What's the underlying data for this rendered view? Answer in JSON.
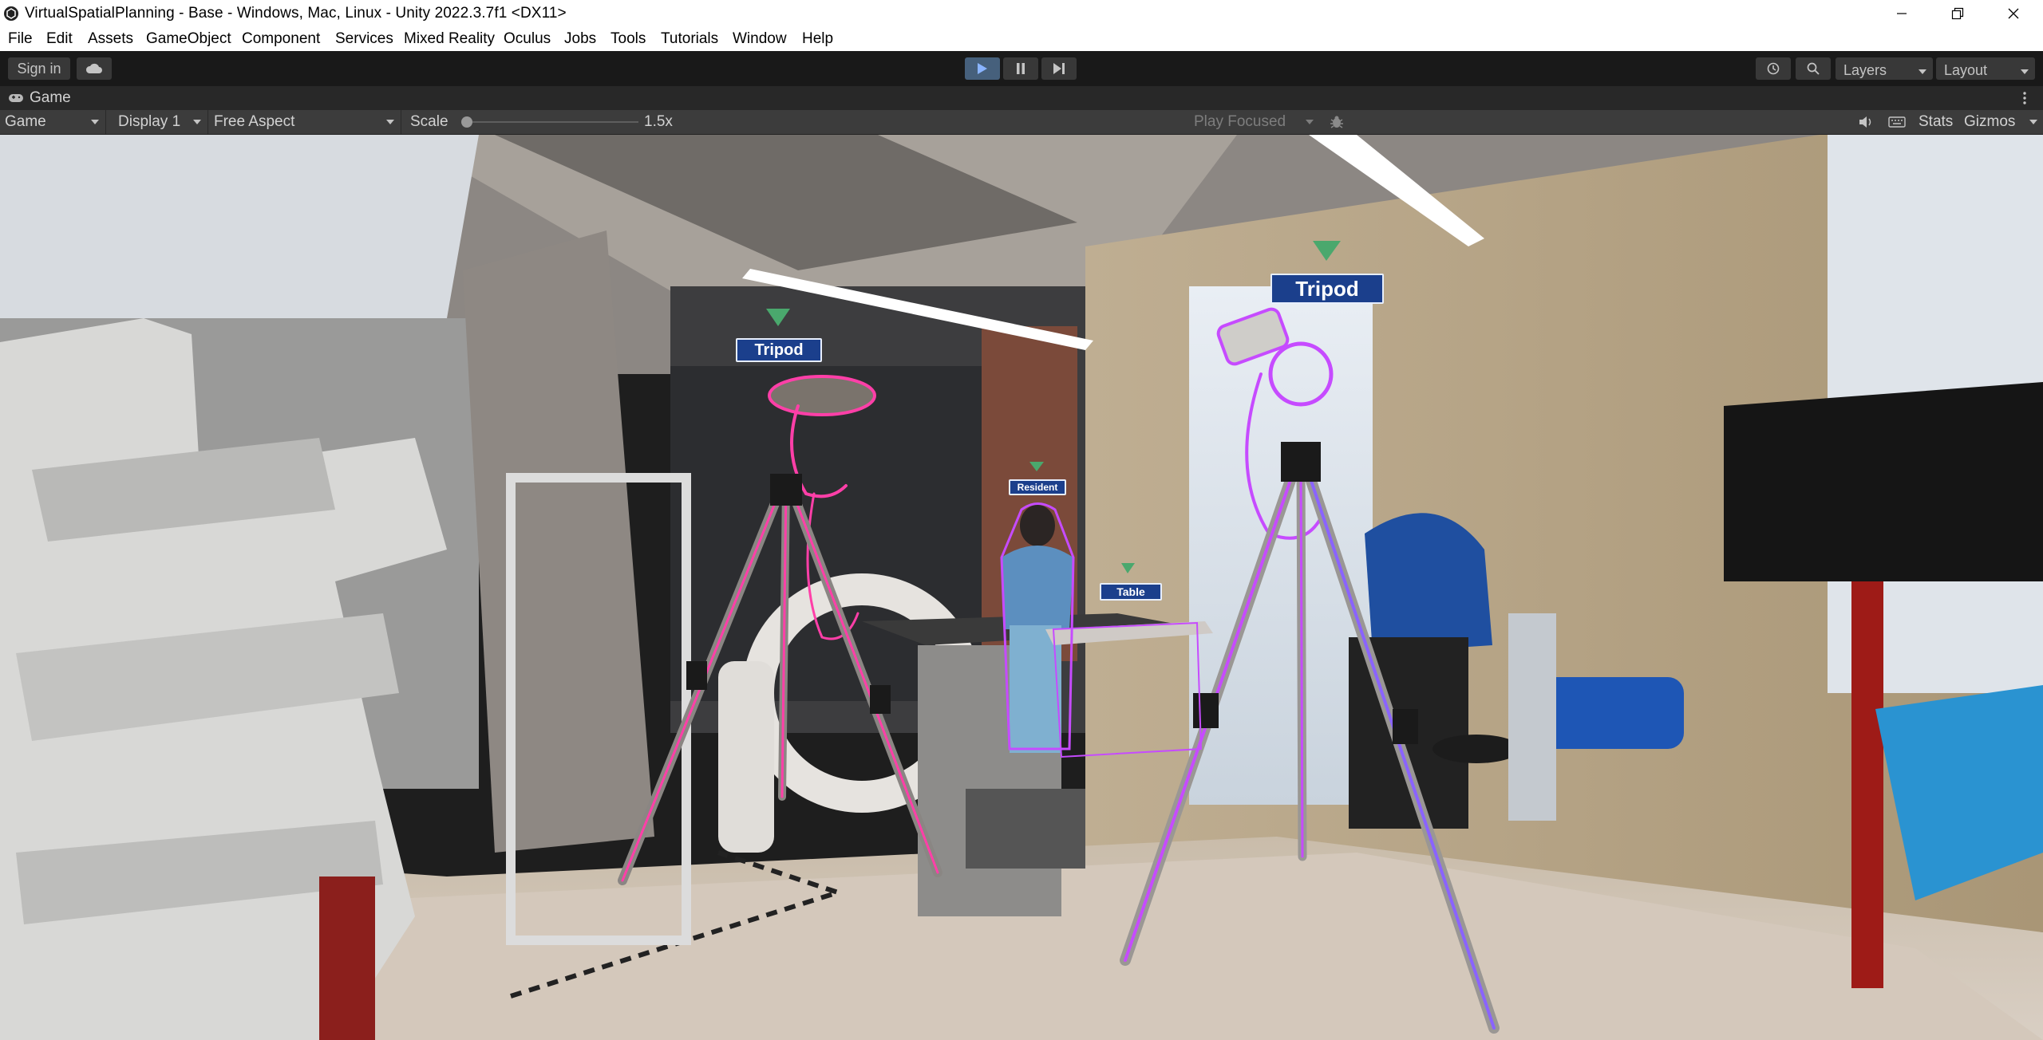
{
  "window": {
    "title": "VirtualSpatialPlanning - Base - Windows, Mac, Linux - Unity 2022.3.7f1 <DX11>",
    "controls": [
      "minimize",
      "restore",
      "close"
    ]
  },
  "menu": [
    "File",
    "Edit",
    "Assets",
    "GameObject",
    "Component",
    "Services",
    "Mixed Reality",
    "Oculus",
    "Jobs",
    "Tools",
    "Tutorials",
    "Window",
    "Help"
  ],
  "toolbar": {
    "sign_in": "Sign in",
    "layers": "Layers",
    "layout": "Layout",
    "play_active": true
  },
  "game_panel": {
    "tab_label": "Game",
    "view_select": "Game",
    "display": "Display 1",
    "aspect": "Free Aspect",
    "scale_label": "Scale",
    "scale_value": "1.5x",
    "scale_slider_fraction": 0.0,
    "play_focused": "Play Focused",
    "stats": "Stats",
    "gizmos": "Gizmos"
  },
  "scene_labels": {
    "tripod_left": "Tripod",
    "tripod_right": "Tripod",
    "resident": "Resident",
    "table": "Table"
  },
  "colors": {
    "play_blue": "#4c7fd6",
    "label_blue": "#1b3f8c",
    "marker_green": "#4aa86d",
    "outline_pink": "#ff3fa8",
    "outline_purple": "#c64bff"
  }
}
